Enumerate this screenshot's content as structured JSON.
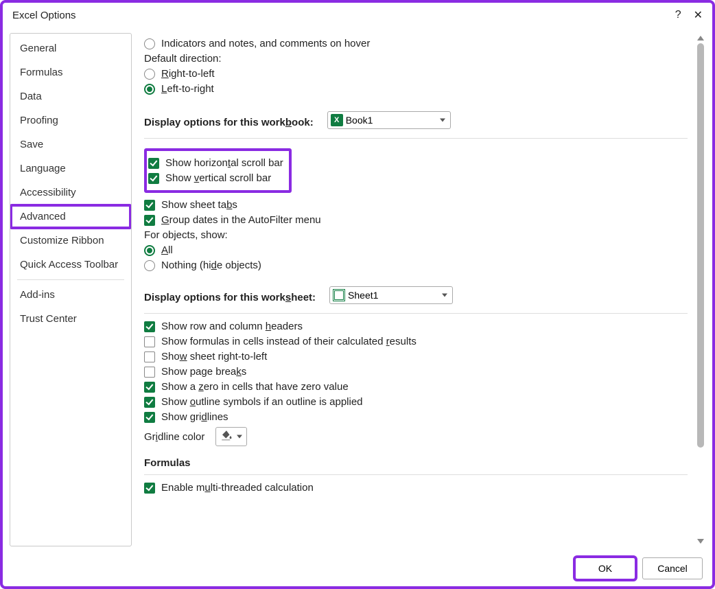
{
  "window": {
    "title": "Excel Options"
  },
  "sidebar": {
    "items": [
      {
        "label": "General"
      },
      {
        "label": "Formulas"
      },
      {
        "label": "Data"
      },
      {
        "label": "Proofing"
      },
      {
        "label": "Save"
      },
      {
        "label": "Language"
      },
      {
        "label": "Accessibility"
      },
      {
        "label": "Advanced",
        "highlight": true,
        "active": true
      },
      {
        "label": "Customize Ribbon"
      },
      {
        "label": "Quick Access Toolbar"
      },
      {
        "label": "Add-ins"
      },
      {
        "label": "Trust Center"
      }
    ],
    "sep_after": [
      9
    ]
  },
  "content": {
    "top_radio": {
      "label": "Indicators and notes, and comments on hover",
      "checked": false
    },
    "default_direction": {
      "label": "Default direction:",
      "rtl": {
        "html": "<u>R</u>ight-to-left",
        "checked": false
      },
      "ltr": {
        "html": "<u>L</u>eft-to-right",
        "checked": true
      }
    },
    "workbook": {
      "heading_html": "Display options for this work<u>b</u>ook:",
      "selected": "Book1",
      "show_h_scroll": {
        "html": "Show horizon<u>t</u>al scroll bar",
        "checked": true
      },
      "show_v_scroll": {
        "html": "Show <u>v</u>ertical scroll bar",
        "checked": true
      },
      "show_tabs": {
        "html": "Show sheet ta<u>b</u>s",
        "checked": true
      },
      "group_dates": {
        "html": "<u>G</u>roup dates in the AutoFilter menu",
        "checked": true
      },
      "for_objects": {
        "label": "For objects, show:",
        "all": {
          "html": "<u>A</u>ll",
          "checked": true
        },
        "nothing": {
          "html": "Nothing (hi<u>d</u>e objects)",
          "checked": false
        }
      }
    },
    "worksheet": {
      "heading_html": "Display options for this work<u>s</u>heet:",
      "selected": "Sheet1",
      "row_col_headers": {
        "html": "Show row and column <u>h</u>eaders",
        "checked": true
      },
      "show_formulas": {
        "html": "Show formulas in cells instead of their calculated <u>r</u>esults",
        "checked": false
      },
      "rtl_sheet": {
        "html": "Sho<u>w</u> sheet right-to-left",
        "checked": false
      },
      "page_breaks": {
        "html": "Show page brea<u>k</u>s",
        "checked": false
      },
      "zero_values": {
        "html": "Show a <u>z</u>ero in cells that have zero value",
        "checked": true
      },
      "outline": {
        "html": "Show <u>o</u>utline symbols if an outline is applied",
        "checked": true
      },
      "gridlines": {
        "html": "Show gri<u>d</u>lines",
        "checked": true
      },
      "gridline_color_label_html": "Gr<u>i</u>dline color"
    },
    "formulas_heading": "Formulas",
    "multithread": {
      "html": "Enable m<u>u</u>lti-threaded calculation",
      "checked": true
    }
  },
  "footer": {
    "ok": "OK",
    "cancel": "Cancel"
  }
}
